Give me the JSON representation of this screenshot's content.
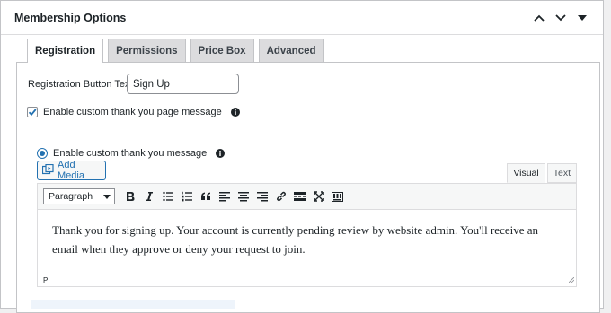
{
  "box": {
    "title": "Membership Options",
    "collapse_icon": "chevron-up-icon",
    "expand_icon": "chevron-down-icon",
    "toggle_icon": "caret-down-icon"
  },
  "tabs": [
    "Registration",
    "Permissions",
    "Price Box",
    "Advanced"
  ],
  "registration": {
    "button_text_label": "Registration Button Text:",
    "button_text_value": "Sign Up",
    "thankyou_checkbox_label": "Enable custom thank you page message",
    "thankyou_checkbox_checked": true,
    "thankyou_radio_label": "Enable custom thank you message",
    "thankyou_radio_selected": true
  },
  "editor": {
    "add_media_label": "Add Media",
    "tabs": [
      "Visual",
      "Text"
    ],
    "active_tab": "Visual",
    "format": "Paragraph",
    "content": "Thank you for signing up. Your account is currently pending review by website admin. You'll receive an email when they approve or deny your request to join.",
    "path": "P"
  },
  "colors": {
    "accent": "#2271b1",
    "border": "#c3c4c7"
  }
}
